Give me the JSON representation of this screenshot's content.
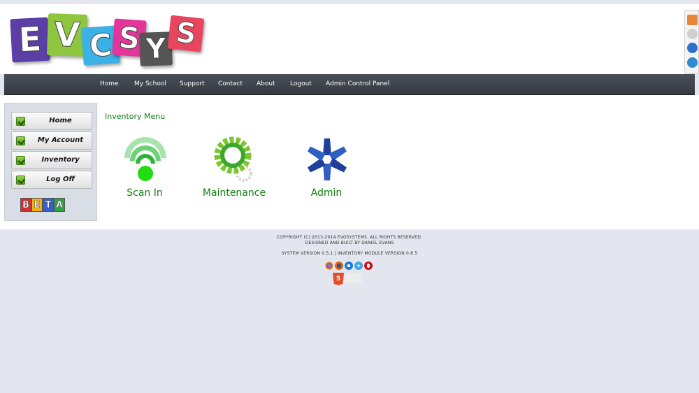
{
  "logo": {
    "letters": [
      "E",
      "V",
      "C",
      "S",
      "Y",
      "S"
    ],
    "tile_colors": [
      "#5b3fa6",
      "#8ec63f",
      "#3cb1e6",
      "#e4359a",
      "#555555",
      "#e8465f"
    ]
  },
  "navbar": {
    "items": [
      "Home",
      "My School",
      "Support",
      "Contact",
      "About",
      "Logout",
      "Admin Control Panel"
    ]
  },
  "sidebar": {
    "items": [
      "Home",
      "My Account",
      "Inventory",
      "Log Off"
    ],
    "badge_letters": [
      "B",
      "E",
      "T",
      "A"
    ]
  },
  "main": {
    "title": "Inventory Menu",
    "tiles": [
      {
        "label": "Scan In",
        "icon": "scan-signal-icon"
      },
      {
        "label": "Maintenance",
        "icon": "gear-icon"
      },
      {
        "label": "Admin",
        "icon": "admin-star-icon"
      }
    ]
  },
  "footer": {
    "copyright": "COPYRIGHT (C) 2013-2014 EVOSYSTEMS. ALL RIGHTS RESERVED.",
    "designed_by": "DESIGNED AND BUILT BY DANIEL EVANS",
    "version": "SYSTEM VERSION 0.5.1 | INVENTORY MODULE VERSION 0.8.5",
    "browsers": [
      "chrome-icon",
      "firefox-icon",
      "ie-icon",
      "safari-icon",
      "opera-icon"
    ],
    "html5_badge": "5"
  },
  "colors": {
    "accent_green": "#0f7d0f",
    "navbar": "#3f444c",
    "page_bg": "#e3e6ee"
  }
}
